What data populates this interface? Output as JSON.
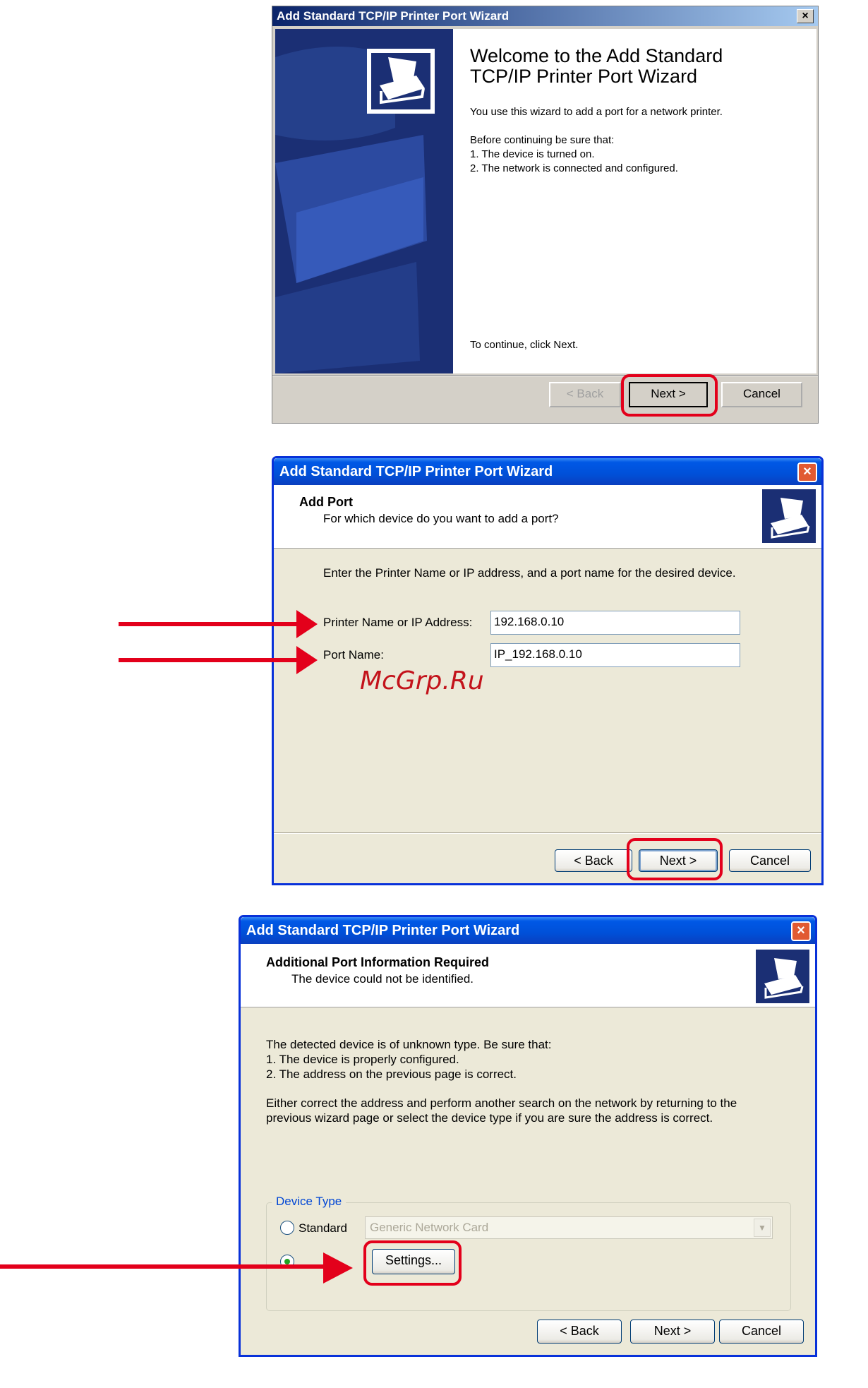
{
  "dialog1": {
    "title": "Add Standard TCP/IP Printer Port Wizard",
    "close_glyph": "×",
    "heading_line1": "Welcome to the Add Standard",
    "heading_line2": "TCP/IP Printer Port Wizard",
    "intro": "You use this wizard to add a port for a network printer.",
    "before": "Before continuing be sure that:",
    "item1": "1.  The device is turned on.",
    "item2": "2.  The network is connected and configured.",
    "continue": "To continue, click Next.",
    "back_label": "< Back",
    "next_label": "Next >",
    "cancel_label": "Cancel"
  },
  "dialog2": {
    "title": "Add Standard TCP/IP Printer Port Wizard",
    "close_glyph": "×",
    "header_title": "Add Port",
    "header_sub": "For which device do you want to add a port?",
    "instruction": "Enter the Printer Name or IP address, and a port name for the desired device.",
    "ip_label": "Printer Name or IP Address:",
    "ip_value": "192.168.0.10",
    "port_label": "Port Name:",
    "port_value": "IP_192.168.0.10",
    "back_label": "< Back",
    "next_label": "Next >",
    "cancel_label": "Cancel"
  },
  "watermark": "McGrp.Ru",
  "dialog3": {
    "title": "Add Standard TCP/IP Printer Port Wizard",
    "close_glyph": "×",
    "header_title": "Additional Port Information Required",
    "header_sub": "The device could not be identified.",
    "line1": "The detected device is of unknown type.  Be sure that:",
    "line2": "1. The device is properly configured.",
    "line3": "2.  The address on the previous page is correct.",
    "line4": "Either correct the address and perform another search on the network by returning to the",
    "line5": "previous wizard page or select the device type if you are sure the address is correct.",
    "group_label": "Device Type",
    "standard_label": "Standard",
    "standard_value": "Generic Network Card",
    "settings_label": "Settings...",
    "back_label": "< Back",
    "next_label": "Next >",
    "cancel_label": "Cancel"
  },
  "colors": {
    "highlight": "#e3001b",
    "xp_title": "#0058e6",
    "classic_title": "#0a246a",
    "dialog_bg": "#ece9d8"
  }
}
